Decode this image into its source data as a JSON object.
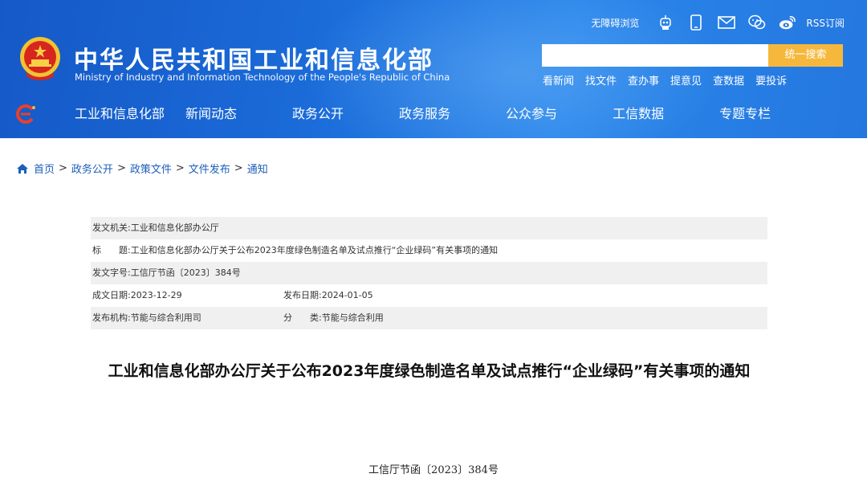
{
  "header": {
    "title_cn": "中华人民共和国工业和信息化部",
    "title_en": "Ministry of Industry and Information Technology of the People's Republic of China",
    "toplinks": {
      "barrier_free": "无障碍浏览",
      "rss": "RSS订阅",
      "icons": [
        "robot-icon",
        "mobile-icon",
        "mail-icon",
        "wechat-icon",
        "weibo-icon",
        "rss-icon"
      ]
    },
    "search": {
      "placeholder": "",
      "button": "统一搜索"
    },
    "quicklinks": [
      "看新闻",
      "找文件",
      "查办事",
      "提意见",
      "查数据",
      "要投诉"
    ],
    "nav": [
      "工业和信息化部",
      "新闻动态",
      "政务公开",
      "政务服务",
      "公众参与",
      "工信数据",
      "专题专栏"
    ],
    "colors": {
      "header_blue": "#1a6ad8",
      "search_button": "#f5b83d"
    }
  },
  "breadcrumb": [
    "首页",
    "政务公开",
    "政策文件",
    "文件发布",
    "通知"
  ],
  "meta": {
    "issuer_label": "发文机关:",
    "issuer_value": "工业和信息化部办公厅",
    "title_label": "标　　题:",
    "title_value": "工业和信息化部办公厅关于公布2023年度绿色制造名单及试点推行“企业绿码”有关事项的通知",
    "docno_label": "发文字号:",
    "docno_value": "工信厅节函〔2023〕384号",
    "created_label": "成文日期:",
    "created_value": "2023-12-29",
    "published_label": "发布日期:",
    "published_value": "2024-01-05",
    "agency_label": "发布机构:",
    "agency_value": "节能与综合利用司",
    "category_label": "分　　类:",
    "category_value": "节能与综合利用"
  },
  "document": {
    "title": "工业和信息化部办公厅关于公布2023年度绿色制造名单及试点推行“企业绿码”有关事项的通知",
    "number": "工信厅节函〔2023〕384号"
  }
}
